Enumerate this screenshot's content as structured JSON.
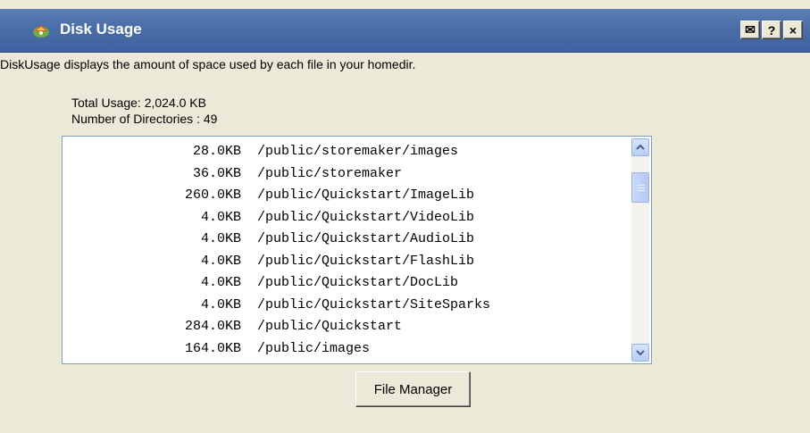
{
  "window": {
    "title": "Disk Usage",
    "buttons": [
      {
        "name": "mail",
        "label": "✉"
      },
      {
        "name": "help",
        "label": "?"
      },
      {
        "name": "close",
        "label": "×"
      }
    ]
  },
  "description": "DiskUsage displays the amount of space used by each file in your homedir.",
  "stats": {
    "total": "Total Usage: 2,024.0 KB",
    "directories": "Number of Directories : 49"
  },
  "list": {
    "items": [
      {
        "size": "28.0KB",
        "path": "/public/storemaker/images"
      },
      {
        "size": "36.0KB",
        "path": "/public/storemaker"
      },
      {
        "size": "260.0KB",
        "path": "/public/Quickstart/ImageLib"
      },
      {
        "size": "4.0KB",
        "path": "/public/Quickstart/VideoLib"
      },
      {
        "size": "4.0KB",
        "path": "/public/Quickstart/AudioLib"
      },
      {
        "size": "4.0KB",
        "path": "/public/Quickstart/FlashLib"
      },
      {
        "size": "4.0KB",
        "path": "/public/Quickstart/DocLib"
      },
      {
        "size": "4.0KB",
        "path": "/public/Quickstart/SiteSparks"
      },
      {
        "size": "284.0KB",
        "path": "/public/Quickstart"
      },
      {
        "size": "164.0KB",
        "path": "/public/images"
      }
    ]
  },
  "file_manager_button": "File Manager",
  "colors": {
    "titlebar": "#4a6da7",
    "window_bg": "#ece9d8"
  }
}
